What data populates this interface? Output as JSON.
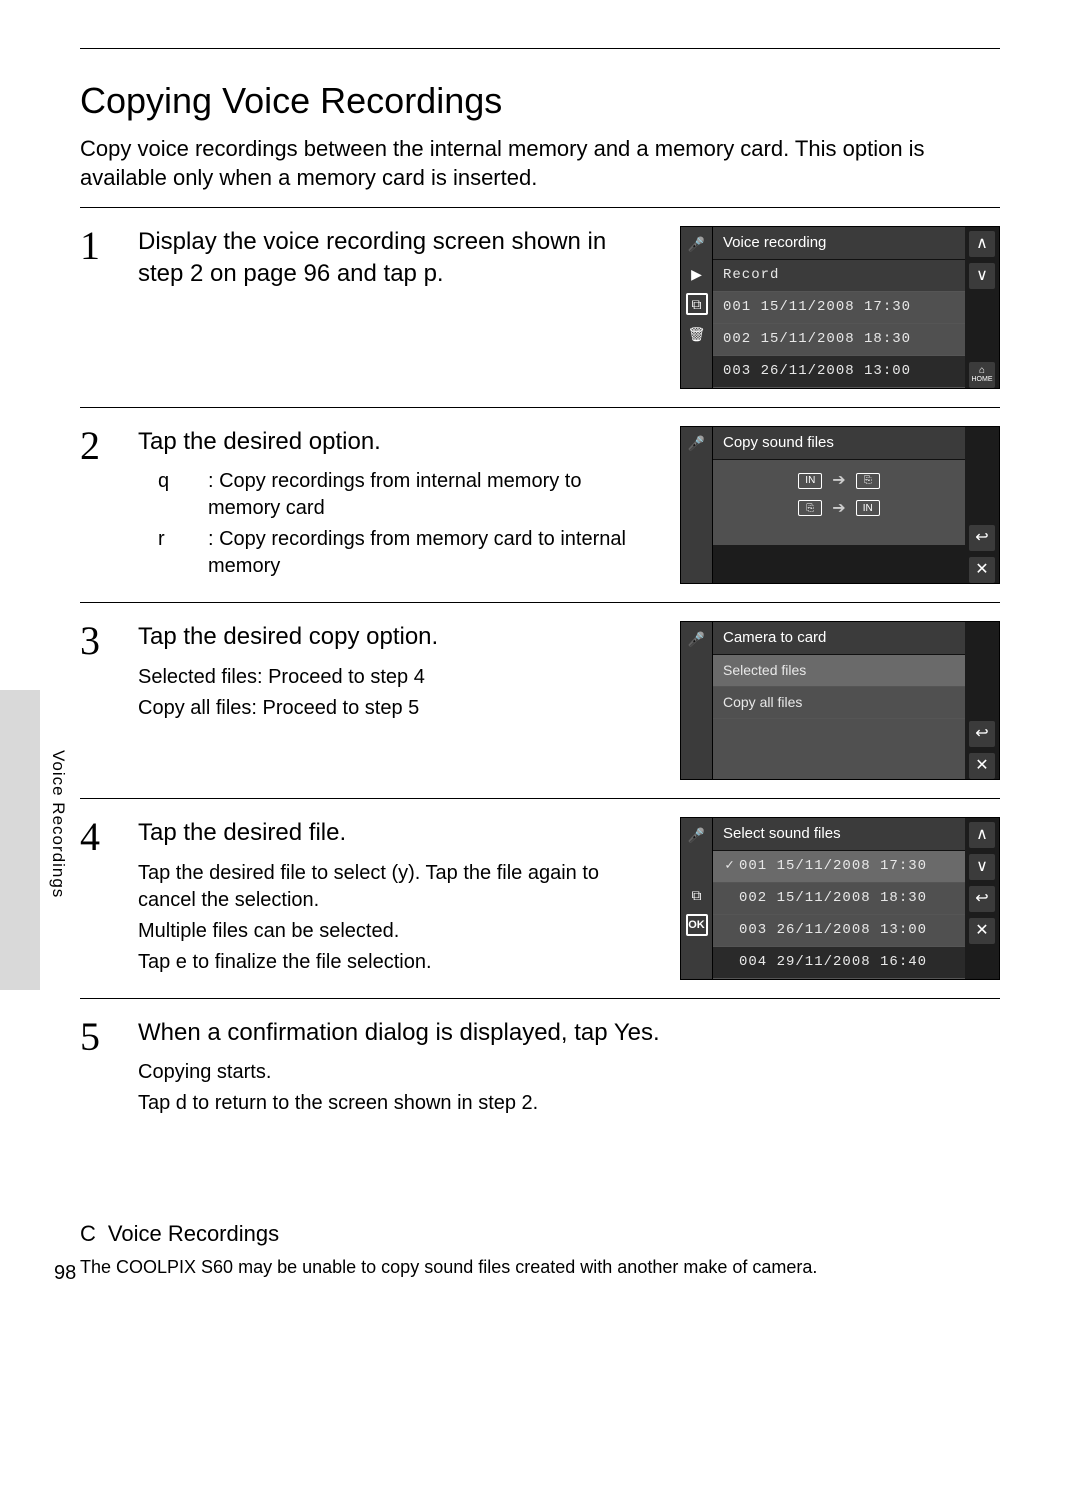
{
  "section_side_label": "Voice Recordings",
  "page_number": "98",
  "title": "Copying Voice Recordings",
  "intro": "Copy voice recordings between the internal memory and a memory card. This option is available only when a memory card is inserted.",
  "steps": [
    {
      "num": "1",
      "head": "Display the voice recording screen shown in step 2 on page 96 and tap p.",
      "lcd": {
        "title": "Voice recording",
        "head_row": "Record",
        "rows": [
          "001 15/11/2008 17:30",
          "002 15/11/2008 18:30",
          "003 26/11/2008 13:00"
        ],
        "left_icons": [
          "mic",
          "play",
          "copy-boxed",
          "trash"
        ],
        "right_icons": [
          "up",
          "down",
          "home"
        ]
      }
    },
    {
      "num": "2",
      "head": "Tap the desired option.",
      "options": [
        {
          "key": "q",
          "text": ": Copy recordings from internal memory to memory card"
        },
        {
          "key": "r",
          "text": ": Copy recordings from memory card to internal memory"
        }
      ],
      "lcd": {
        "title": "Copy sound files",
        "dir_rows": [
          {
            "from": "IN",
            "to": "CARD"
          },
          {
            "from": "CARD",
            "to": "IN"
          }
        ],
        "left_icons": [
          "mic"
        ],
        "right_icons": [
          "back",
          "close"
        ]
      }
    },
    {
      "num": "3",
      "head": "Tap the desired copy option.",
      "subs": [
        "Selected files: Proceed to step 4",
        "Copy all files: Proceed to step 5"
      ],
      "lcd": {
        "title": "Camera to card",
        "menu_rows": [
          "Selected files",
          "Copy all files"
        ],
        "left_icons": [
          "mic"
        ],
        "right_icons": [
          "back",
          "close"
        ]
      }
    },
    {
      "num": "4",
      "head": "Tap the desired file.",
      "subs": [
        "Tap the desired file to select (y). Tap the file again to cancel the selection.",
        "Multiple files can be selected.",
        "Tap e to finalize the file selection."
      ],
      "lcd": {
        "title": "Select sound files",
        "rows_checked": [
          {
            "chk": "✓",
            "text": "001 15/11/2008 17:30"
          },
          {
            "chk": "",
            "text": "002 15/11/2008 18:30"
          },
          {
            "chk": "",
            "text": "003 26/11/2008 13:00"
          },
          {
            "chk": "",
            "text": "004 29/11/2008 16:40"
          }
        ],
        "left_icons": [
          "mic",
          "blank",
          "copy",
          "ok"
        ],
        "right_icons": [
          "up",
          "down",
          "back",
          "close"
        ]
      }
    },
    {
      "num": "5",
      "head": "When a confirmation dialog is displayed, tap Yes.",
      "subs": [
        "Copying starts.",
        "Tap d to return to the screen shown in step 2."
      ]
    }
  ],
  "note": {
    "mark": "C",
    "head": "Voice Recordings",
    "body": "The COOLPIX S60 may be unable to copy sound files created with another make of camera."
  }
}
